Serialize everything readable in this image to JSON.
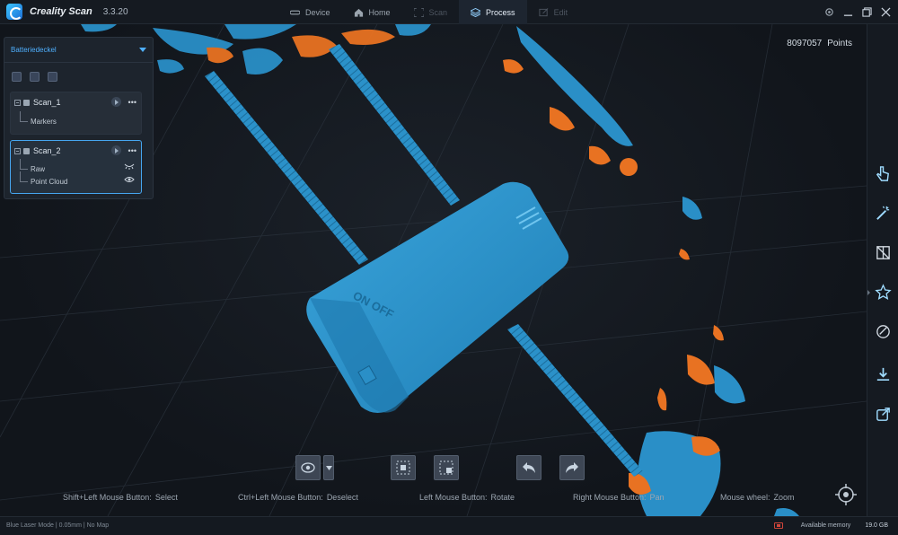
{
  "app": {
    "name": "Creality Scan",
    "version": "3.3.20"
  },
  "nav": [
    {
      "label": "Device",
      "state": "normal"
    },
    {
      "label": "Home",
      "state": "normal"
    },
    {
      "label": "Scan",
      "state": "disabled"
    },
    {
      "label": "Process",
      "state": "active"
    },
    {
      "label": "Edit",
      "state": "disabled"
    }
  ],
  "viewport": {
    "points_value": "8097057",
    "points_label": "Points"
  },
  "panel": {
    "project": "Batteriedeckel",
    "scans": [
      {
        "name": "Scan_1",
        "children": [
          "Markers"
        ]
      },
      {
        "name": "Scan_2",
        "children": [
          "Raw",
          "Point Cloud"
        ]
      }
    ],
    "more_label": "•••"
  },
  "hints": [
    {
      "key": "Shift+Left Mouse Button:",
      "action": "Select"
    },
    {
      "key": "Ctrl+Left Mouse Button:",
      "action": "Deselect"
    },
    {
      "key": "Left Mouse Button:",
      "action": "Rotate"
    },
    {
      "key": "Right Mouse Button:",
      "action": "Pan"
    },
    {
      "key": "Mouse wheel:",
      "action": "Zoom"
    }
  ],
  "status": {
    "left": "Blue Laser Mode | 0.05mm | No Map",
    "memory_label": "Available memory",
    "memory_value": "19.0 GB"
  },
  "colors": {
    "accent": "#3a9de6",
    "model_blue": "#2a8fc7",
    "point_orange": "#e87222",
    "background": "#11151b"
  },
  "icons": {
    "right_toolbar": [
      "select-pointer-icon",
      "magic-wand-icon",
      "mesh-icon",
      "star-icon",
      "texture-icon",
      "download-icon",
      "export-icon"
    ]
  }
}
